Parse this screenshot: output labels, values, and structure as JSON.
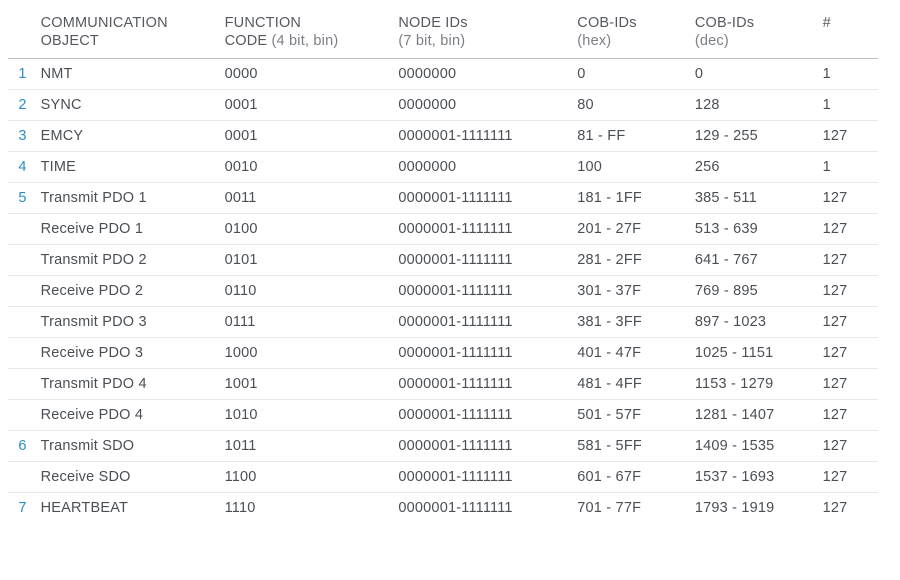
{
  "headers": {
    "obj": {
      "line1": "COMMUNICATION",
      "line2": "OBJECT"
    },
    "fc": {
      "line1": "FUNCTION",
      "line2_strong": "CODE",
      "line2_sub": " (4 bit, bin)"
    },
    "nid": {
      "line1": "NODE IDs",
      "line2_sub": "(7 bit, bin)"
    },
    "chex": {
      "line1": "COB-IDs",
      "line2_sub": "(hex)"
    },
    "cdec": {
      "line1": "COB-IDs",
      "line2_sub": "(dec)"
    },
    "cnt": {
      "line1": "#"
    }
  },
  "rows": [
    {
      "idx": "1",
      "obj": "NMT",
      "fc": "0000",
      "nid": "0000000",
      "chex": "0",
      "cdec": "0",
      "cnt": "1"
    },
    {
      "idx": "2",
      "obj": "SYNC",
      "fc": "0001",
      "nid": "0000000",
      "chex": "80",
      "cdec": "128",
      "cnt": "1"
    },
    {
      "idx": "3",
      "obj": "EMCY",
      "fc": "0001",
      "nid": "0000001-1111111",
      "chex": "81 - FF",
      "cdec": "129 - 255",
      "cnt": "127"
    },
    {
      "idx": "4",
      "obj": "TIME",
      "fc": "0010",
      "nid": "0000000",
      "chex": "100",
      "cdec": "256",
      "cnt": "1"
    },
    {
      "idx": "5",
      "obj": "Transmit PDO 1",
      "fc": "0011",
      "nid": "0000001-1111111",
      "chex": "181 - 1FF",
      "cdec": "385 - 511",
      "cnt": "127"
    },
    {
      "idx": "",
      "obj": "Receive PDO 1",
      "fc": "0100",
      "nid": "0000001-1111111",
      "chex": "201 - 27F",
      "cdec": "513 - 639",
      "cnt": "127"
    },
    {
      "idx": "",
      "obj": "Transmit PDO 2",
      "fc": "0101",
      "nid": "0000001-1111111",
      "chex": "281 - 2FF",
      "cdec": "641 - 767",
      "cnt": "127"
    },
    {
      "idx": "",
      "obj": "Receive PDO 2",
      "fc": "0110",
      "nid": "0000001-1111111",
      "chex": "301 - 37F",
      "cdec": "769 - 895",
      "cnt": "127"
    },
    {
      "idx": "",
      "obj": "Transmit PDO 3",
      "fc": "0111",
      "nid": "0000001-1111111",
      "chex": "381 - 3FF",
      "cdec": "897 - 1023",
      "cnt": "127"
    },
    {
      "idx": "",
      "obj": "Receive PDO 3",
      "fc": "1000",
      "nid": "0000001-1111111",
      "chex": "401 - 47F",
      "cdec": "1025 - 1151",
      "cnt": "127"
    },
    {
      "idx": "",
      "obj": "Transmit PDO 4",
      "fc": "1001",
      "nid": "0000001-1111111",
      "chex": "481 - 4FF",
      "cdec": "1153 - 1279",
      "cnt": "127"
    },
    {
      "idx": "",
      "obj": "Receive PDO 4",
      "fc": "1010",
      "nid": "0000001-1111111",
      "chex": "501 - 57F",
      "cdec": "1281 - 1407",
      "cnt": "127"
    },
    {
      "idx": "6",
      "obj": "Transmit SDO",
      "fc": "1011",
      "nid": "0000001-1111111",
      "chex": "581 - 5FF",
      "cdec": "1409 - 1535",
      "cnt": "127"
    },
    {
      "idx": "",
      "obj": "Receive SDO",
      "fc": "1100",
      "nid": "0000001-1111111",
      "chex": "601 - 67F",
      "cdec": "1537 - 1693",
      "cnt": "127"
    },
    {
      "idx": "7",
      "obj": "HEARTBEAT",
      "fc": "1110",
      "nid": "0000001-1111111",
      "chex": "701 - 77F",
      "cdec": "1793 - 1919",
      "cnt": "127"
    }
  ]
}
